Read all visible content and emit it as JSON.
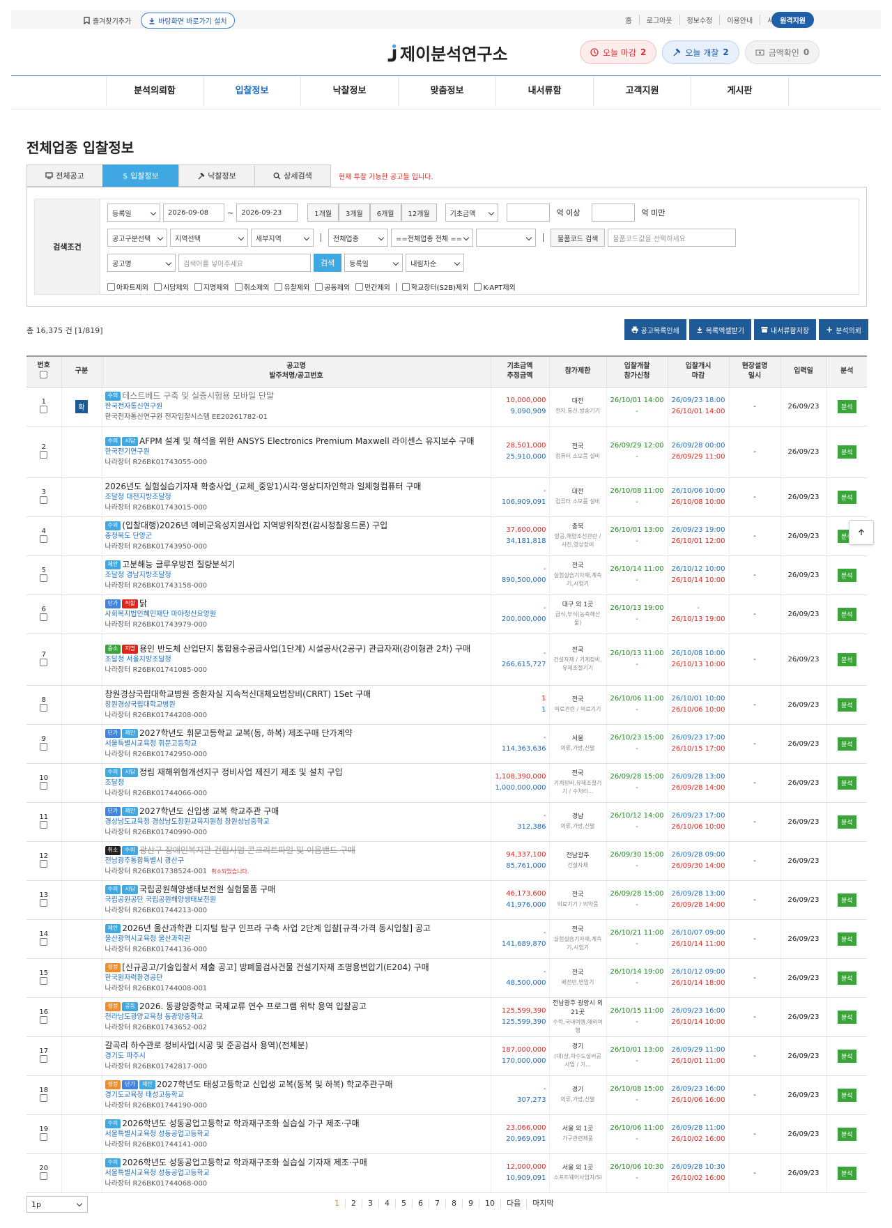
{
  "topbar": {
    "favorite": "즐겨찾기추가",
    "install": "바탕화면 바로가기 설치",
    "links": [
      "홈",
      "로그아웃",
      "정보수정",
      "이용안내",
      "사이트맵"
    ],
    "remote": "원격지원"
  },
  "brand": {
    "name": "제이분석연구소",
    "mark": "J"
  },
  "pills": [
    {
      "label": "오늘 마감",
      "count": "2",
      "icon": "clock-icon"
    },
    {
      "label": "오늘 개찰",
      "count": "2",
      "icon": "gavel-icon"
    },
    {
      "label": "금액확인",
      "count": "0",
      "icon": "money-icon"
    }
  ],
  "gnb": [
    "분석의뢰함",
    "입찰정보",
    "낙찰정보",
    "맞춤정보",
    "내서류함",
    "고객지원",
    "게시판"
  ],
  "page_title": "전체업종 입찰정보",
  "tabs": [
    {
      "label": "전체공고",
      "icon": "monitor-icon"
    },
    {
      "label": "입찰정보",
      "icon": "dollar-icon"
    },
    {
      "label": "낙찰정보",
      "icon": "gavel-icon"
    },
    {
      "label": "상세검색",
      "icon": "search-icon"
    }
  ],
  "tab_note": "현재 투찰 가능한 공고들 입니다.",
  "search": {
    "label": "검색조건",
    "date_type": "등록일",
    "date_from": "2026-09-08",
    "tilde": "~",
    "date_to": "2026-09-23",
    "periods": [
      "1개월",
      "3개월",
      "6개월",
      "12개월"
    ],
    "amount_type": "기초금액",
    "min_unit": "억 이상",
    "max_unit": "억 미만",
    "class_sel": "공고구분선택",
    "region_sel": "지역선택",
    "subregion_sel": "세부지역",
    "industry_sel": "전체업종",
    "industry_sub": "==전체업종 전체 ==",
    "item_btn": "물품코드 검색",
    "item_ph": "물품코드값을 선택하세요",
    "field_sel": "공고명",
    "keyword_ph": "검색어를 넣어주세요",
    "search_btn": "검색",
    "sort_sel": "등록일",
    "order_sel": "내림차순",
    "excludes": [
      "아파트제외",
      "시담제외",
      "지명제외",
      "취소제외",
      "유찰제외",
      "공동제외",
      "민간제외",
      "학교장터(S2B)제외",
      "K-APT제외"
    ]
  },
  "total": "총 16,375 건 [1/819]",
  "actions": [
    {
      "label": "공고목록인쇄",
      "icon": "print-icon"
    },
    {
      "label": "목록엑셀받기",
      "icon": "download-icon"
    },
    {
      "label": "내서류함저장",
      "icon": "folder-icon"
    },
    {
      "label": "분석의뢰",
      "icon": "plus-icon"
    }
  ],
  "columns": {
    "no": "번호",
    "kind": "구분",
    "title1": "공고명",
    "title2": "발주처명/공고번호",
    "price1": "기초금액",
    "price2": "추정금액",
    "limit": "참가제한",
    "open1": "입찰개찰",
    "open2": "참가신청",
    "start1": "입찰개시",
    "start2": "마감",
    "site1": "현장설명",
    "site2": "일시",
    "reg": "입력일",
    "analysis": "분석"
  },
  "rows": [
    {
      "no": "1",
      "kind": "확",
      "badges": [
        {
          "t": "수의",
          "c": "#3fa7e2"
        }
      ],
      "title": "테스트베드 구축 및 실증시험용 모바일 단말",
      "title_gray": true,
      "org": "한국전자통신연구원",
      "code": "한국전자통신연구원 전자입찰시스템 EE20261782-01",
      "p1": "10,000,000",
      "p2": "9,090,909",
      "lim1": "대전",
      "lim2": "전자.통신.방송기기",
      "o1": "26/10/01 14:00",
      "o2": "-",
      "s1": "26/09/23 18:00",
      "s2": "26/10/01 14:00",
      "site": "-",
      "reg": "26/09/23",
      "an": "분석"
    },
    {
      "no": "2",
      "kind": "",
      "badges": [
        {
          "t": "수의",
          "c": "#3fa7e2"
        },
        {
          "t": "시담",
          "c": "#3fa7e2"
        }
      ],
      "title": "AFPM 설계 및 해석을 위한 ANSYS Electronics Premium Maxwell 라이센스 유지보수 구매",
      "org": "한국전기연구원",
      "code": "나라장터 R26BK01743055-000",
      "p1": "28,501,000",
      "p2": "25,910,000",
      "lim1": "전국",
      "lim2": "컴퓨터 소모품 설비",
      "o1": "26/09/29 12:00",
      "o2": "-",
      "s1": "26/09/28 00:00",
      "s2": "26/09/29 11:00",
      "site": "-",
      "reg": "26/09/23",
      "an": "분석"
    },
    {
      "no": "3",
      "kind": "",
      "badges": [],
      "title": "2026년도 실험실습기자재 확충사업_(교체_중앙1)시각·영상디자인학과 일체형컴퓨터 구매",
      "org": "조달청 대전지방조달청",
      "code": "나라장터 R26BK01743015-000",
      "p1": "-",
      "p2": "106,909,091",
      "lim1": "대전",
      "lim2": "컴퓨터 소모품 설비",
      "o1": "26/10/08 11:00",
      "o2": "-",
      "s1": "26/10/06 10:00",
      "s2": "26/10/08 10:00",
      "site": "-",
      "reg": "26/09/23",
      "an": "분석"
    },
    {
      "no": "4",
      "kind": "",
      "badges": [
        {
          "t": "수의",
          "c": "#3fa7e2"
        }
      ],
      "title": "(입찰대행)2026년 예비군육성지원사업 지역방위작전(감시정찰용드론) 구입",
      "org": "충청북도 단양군",
      "code": "나라장터 R26BK01743950-000",
      "p1": "37,600,000",
      "p2": "34,181,818",
      "lim1": "충북",
      "lim2": "항공,해양조선관련 / 사진,영상장비",
      "o1": "26/10/01 13:00",
      "o2": "-",
      "s1": "26/09/23 19:00",
      "s2": "26/10/01 12:00",
      "site": "-",
      "reg": "26/09/23",
      "an": "분석"
    },
    {
      "no": "5",
      "kind": "",
      "badges": [
        {
          "t": "제안",
          "c": "#3fa7e2"
        }
      ],
      "title": "고분해능 글루우방전 질량분석기",
      "org": "조달청 경남지방조달청",
      "code": "나라장터 R26BK01743158-000",
      "p1": "-",
      "p2": "890,500,000",
      "lim1": "전국",
      "lim2": "실험실습기자재,계측기,시험기",
      "o1": "26/10/14 11:00",
      "o2": "-",
      "s1": "26/10/12 10:00",
      "s2": "26/10/14 10:00",
      "site": "-",
      "reg": "26/09/23",
      "an": "분석"
    },
    {
      "no": "6",
      "kind": "",
      "badges": [
        {
          "t": "단가",
          "c": "#3f84e2"
        },
        {
          "t": "직할",
          "c": "#e2231a"
        }
      ],
      "title": "닭",
      "org": "사회복지법인혜민재단 마야정신요양원",
      "code": "나라장터 R26BK01743979-000",
      "p1": "-",
      "p2": "200,000,000",
      "lim1": "대구 외 1곳",
      "lim2": "급식,부식(농축해산물)",
      "o1": "26/10/13 19:00",
      "o2": "-",
      "s1": "-",
      "s2": "26/10/13 19:00",
      "site": "-",
      "reg": "26/09/23",
      "an": "분석"
    },
    {
      "no": "7",
      "kind": "",
      "badges": [
        {
          "t": "중소",
          "c": "#3aa63a"
        },
        {
          "t": "지명",
          "c": "#e2231a"
        }
      ],
      "title": "용인 반도체 산업단지 통합용수공급사업(1단계) 시설공사(2공구) 관급자재(강이형관 2차) 구매",
      "org": "조달청 서울지방조달청",
      "code": "나라장터 R26BK01741085-000",
      "p1": "-",
      "p2": "266,615,727",
      "lim1": "전국",
      "lim2": "건설자재 / 기계장비,유체조절기기",
      "o1": "26/10/13 11:00",
      "o2": "-",
      "s1": "26/10/08 10:00",
      "s2": "26/10/13 10:00",
      "site": "-",
      "reg": "26/09/23",
      "an": "분석"
    },
    {
      "no": "8",
      "kind": "",
      "badges": [],
      "title": "창원경상국립대학교병원 중환자실 지속적신대체요법장비(CRRT) 1Set 구매",
      "org": "창원경상국립대학교병원",
      "code": "나라장터 R26BK01744208-000",
      "p1": "1",
      "p2": "1",
      "lim1": "전국",
      "lim2": "의료관련 / 의료기기",
      "o1": "26/10/06 11:00",
      "o2": "-",
      "s1": "26/10/01 10:00",
      "s2": "26/10/06 10:00",
      "site": "-",
      "reg": "26/09/23",
      "an": "분석"
    },
    {
      "no": "9",
      "kind": "",
      "badges": [
        {
          "t": "단가",
          "c": "#3f84e2"
        },
        {
          "t": "제안",
          "c": "#3fa7e2"
        }
      ],
      "title": "2027학년도 휘문고등학교 교복(동, 하복) 제조구매 단가계약",
      "org": "서울특별시교육청 휘문고등학교",
      "code": "나라장터 R26BK01742950-000",
      "p1": "-",
      "p2": "114,363,636",
      "lim1": "서울",
      "lim2": "의류,가방,신발",
      "o1": "26/10/23 15:00",
      "o2": "-",
      "s1": "26/09/23 17:00",
      "s2": "26/10/15 17:00",
      "site": "-",
      "reg": "26/09/23",
      "an": "분석"
    },
    {
      "no": "10",
      "kind": "",
      "badges": [
        {
          "t": "수의",
          "c": "#3fa7e2"
        },
        {
          "t": "시담",
          "c": "#3fa7e2"
        }
      ],
      "title": "정림 재해위험개선지구 정비사업 제진기 제조 및 설치 구입",
      "org": "조달청",
      "code": "나라장터 R26BK01744066-000",
      "p1": "1,108,390,000",
      "p2": "1,000,000,000",
      "lim1": "전국",
      "lim2": "기계장비,유체조절기기 / 수처리...",
      "o1": "26/09/28 15:00",
      "o2": "-",
      "s1": "26/09/28 13:00",
      "s2": "26/09/28 14:00",
      "site": "-",
      "reg": "26/09/23",
      "an": "분석"
    },
    {
      "no": "11",
      "kind": "",
      "badges": [
        {
          "t": "단가",
          "c": "#3f84e2"
        },
        {
          "t": "제안",
          "c": "#3fa7e2"
        }
      ],
      "title": "2027학년도 신입생 교복 학교주관 구매",
      "org": "경상남도교육청 경상남도창원교육지원청 창원상남중학교",
      "code": "나라장터 R26BK01740990-000",
      "p1": "-",
      "p2": "312,386",
      "lim1": "경남",
      "lim2": "의류,가방,신발",
      "o1": "26/10/12 14:00",
      "o2": "-",
      "s1": "26/09/23 17:00",
      "s2": "26/10/06 10:00",
      "site": "-",
      "reg": "26/09/23",
      "an": "분석"
    },
    {
      "no": "12",
      "kind": "",
      "badges": [
        {
          "t": "취소",
          "c": "#222"
        },
        {
          "t": "수의",
          "c": "#3fa7e2"
        }
      ],
      "title": "광산구 장애인복지관 건립사업 콘크리트파일 및 이음밴드 구매",
      "strike": true,
      "org": "전남광주통합특별시 광산구",
      "code": "나라장터 R26BK01738524-001",
      "cancel": "취소되었습니다.",
      "p1": "94,337,100",
      "p2": "85,761,000",
      "lim1": "전남광주",
      "lim2": "건설자재",
      "o1": "26/09/30 15:00",
      "o2": "-",
      "s1": "26/09/28 09:00",
      "s2": "26/09/30 14:00",
      "site": "-",
      "reg": "26/09/23",
      "an": ""
    },
    {
      "no": "13",
      "kind": "",
      "badges": [
        {
          "t": "수의",
          "c": "#3fa7e2"
        },
        {
          "t": "시담",
          "c": "#3fa7e2"
        }
      ],
      "title": "국립공원해양생태보전원 실험물품 구매",
      "org": "국립공원공단 국립공원해양생태보전원",
      "code": "나라장터 R26BK01744213-000",
      "p1": "46,173,600",
      "p2": "41,976,000",
      "lim1": "전국",
      "lim2": "의료기기 / 의약품",
      "o1": "26/09/28 15:00",
      "o2": "-",
      "s1": "26/09/28 13:00",
      "s2": "26/09/28 14:00",
      "site": "-",
      "reg": "26/09/23",
      "an": "분석"
    },
    {
      "no": "14",
      "kind": "",
      "badges": [
        {
          "t": "제안",
          "c": "#3fa7e2"
        }
      ],
      "title": "2026년 울산과학관 디지털 탐구 인프라 구축 사업 2단계 입찰[규격·가격 동시입찰] 공고",
      "org": "울산광역시교육청 울산과학관",
      "code": "나라장터 R26BK01744136-000",
      "p1": "-",
      "p2": "141,689,870",
      "lim1": "전국",
      "lim2": "실험실습기자재,계측기,시험기",
      "o1": "26/10/21 11:00",
      "o2": "-",
      "s1": "26/10/07 09:00",
      "s2": "26/10/14 11:00",
      "site": "-",
      "reg": "26/09/23",
      "an": "분석"
    },
    {
      "no": "15",
      "kind": "",
      "badges": [
        {
          "t": "정정",
          "c": "#f08c2a"
        }
      ],
      "title": "[신규공고/기술입찰서 제출 공고] 방폐물검사건물 건설기자재 조명용변압기(E204) 구매",
      "org": "한국원자력환경공단",
      "code": "나라장터 R26BK01744008-001",
      "p1": "-",
      "p2": "48,500,000",
      "lim1": "전국",
      "lim2": "배전반,변압기",
      "o1": "26/10/14 19:00",
      "o2": "-",
      "s1": "26/10/12 09:00",
      "s2": "26/10/14 18:00",
      "site": "-",
      "reg": "26/09/23",
      "an": "분석"
    },
    {
      "no": "16",
      "kind": "",
      "badges": [
        {
          "t": "정정",
          "c": "#f08c2a"
        },
        {
          "t": "공동",
          "c": "#3fa7e2"
        }
      ],
      "title": "2026. 동광양중학교 국제교류 연수 프로그램 위탁 용역 입찰공고",
      "org": "전라남도광양교육청 동광양중학교",
      "code": "나라장터 R26BK01743652-002",
      "p1": "125,599,390",
      "p2": "125,599,390",
      "lim1": "전남광주 광양시 외 21곳",
      "lim2": "수학,국내여행,해외여행",
      "o1": "26/10/15 11:00",
      "o2": "-",
      "s1": "26/09/23 16:00",
      "s2": "26/10/14 10:00",
      "site": "-",
      "reg": "26/09/23",
      "an": "분석"
    },
    {
      "no": "17",
      "kind": "",
      "badges": [],
      "title": "갈곡리 하수관로 정비사업(시공 및 준공검사 용역)(전체분)",
      "org": "경기도 파주시",
      "code": "나라장터 R26BK01742817-000",
      "p1": "187,000,000",
      "p2": "170,000,000",
      "lim1": "경기",
      "lim2": "(대)상,하수도설비공사업 / 기...",
      "o1": "26/10/01 13:00",
      "o2": "-",
      "s1": "26/09/29 11:00",
      "s2": "26/10/01 11:00",
      "site": "-",
      "reg": "26/09/23",
      "an": "분석"
    },
    {
      "no": "18",
      "kind": "",
      "badges": [
        {
          "t": "정정",
          "c": "#f08c2a"
        },
        {
          "t": "단가",
          "c": "#3f84e2"
        },
        {
          "t": "제안",
          "c": "#3fa7e2"
        }
      ],
      "title": "2027학년도 태성고등학교 신입생 교복(동복 및 하복) 학교주관구매",
      "org": "경기도교육청 태성고등학교",
      "code": "나라장터 R26BK01744190-000",
      "p1": "-",
      "p2": "307,273",
      "lim1": "경기",
      "lim2": "의류,가방,신발",
      "o1": "26/10/08 15:00",
      "o2": "-",
      "s1": "26/09/23 16:00",
      "s2": "26/10/06 16:00",
      "site": "-",
      "reg": "26/09/23",
      "an": "분석"
    },
    {
      "no": "19",
      "kind": "",
      "badges": [
        {
          "t": "수의",
          "c": "#3fa7e2"
        }
      ],
      "title": "2026학년도 성동공업고등학교 학과재구조화 실습실 가구 제조·구매",
      "org": "서울특별시교육청 성동공업고등학교",
      "code": "나라장터 R26BK01744141-000",
      "p1": "23,066,000",
      "p2": "20,969,091",
      "lim1": "서울 외 1곳",
      "lim2": "가구관련제품",
      "o1": "26/10/06 11:00",
      "o2": "-",
      "s1": "26/09/28 11:00",
      "s2": "26/10/02 16:00",
      "site": "-",
      "reg": "26/09/23",
      "an": "분석"
    },
    {
      "no": "20",
      "kind": "",
      "badges": [
        {
          "t": "수의",
          "c": "#3fa7e2"
        }
      ],
      "title": "2026학년도 성동공업고등학교 학과재구조화 실습실 기자재 제조·구매",
      "org": "서울특별시교육청 성동공업고등학교",
      "code": "나라장터 R26BK01744068-000",
      "p1": "12,000,000",
      "p2": "10,909,091",
      "lim1": "서울 외 1곳",
      "lim2": "소프트웨어사업자/SI",
      "o1": "26/10/06 10:30",
      "o2": "-",
      "s1": "26/09/28 10:30",
      "s2": "26/10/02 16:00",
      "site": "-",
      "reg": "26/09/23",
      "an": "분석"
    }
  ],
  "pager": {
    "size": "1p",
    "pages": [
      "1",
      "2",
      "3",
      "4",
      "5",
      "6",
      "7",
      "8",
      "9",
      "10"
    ],
    "next": "다음",
    "last": "마지막"
  }
}
